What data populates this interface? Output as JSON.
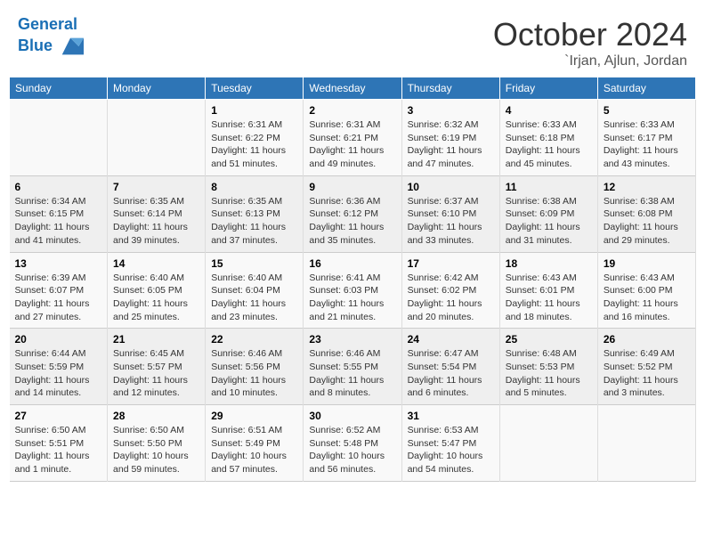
{
  "header": {
    "logo_line1": "General",
    "logo_line2": "Blue",
    "month": "October 2024",
    "location": "`Irjan, Ajlun, Jordan"
  },
  "weekdays": [
    "Sunday",
    "Monday",
    "Tuesday",
    "Wednesday",
    "Thursday",
    "Friday",
    "Saturday"
  ],
  "weeks": [
    [
      null,
      null,
      {
        "day": "1",
        "sunrise": "Sunrise: 6:31 AM",
        "sunset": "Sunset: 6:22 PM",
        "daylight": "Daylight: 11 hours and 51 minutes."
      },
      {
        "day": "2",
        "sunrise": "Sunrise: 6:31 AM",
        "sunset": "Sunset: 6:21 PM",
        "daylight": "Daylight: 11 hours and 49 minutes."
      },
      {
        "day": "3",
        "sunrise": "Sunrise: 6:32 AM",
        "sunset": "Sunset: 6:19 PM",
        "daylight": "Daylight: 11 hours and 47 minutes."
      },
      {
        "day": "4",
        "sunrise": "Sunrise: 6:33 AM",
        "sunset": "Sunset: 6:18 PM",
        "daylight": "Daylight: 11 hours and 45 minutes."
      },
      {
        "day": "5",
        "sunrise": "Sunrise: 6:33 AM",
        "sunset": "Sunset: 6:17 PM",
        "daylight": "Daylight: 11 hours and 43 minutes."
      }
    ],
    [
      {
        "day": "6",
        "sunrise": "Sunrise: 6:34 AM",
        "sunset": "Sunset: 6:15 PM",
        "daylight": "Daylight: 11 hours and 41 minutes."
      },
      {
        "day": "7",
        "sunrise": "Sunrise: 6:35 AM",
        "sunset": "Sunset: 6:14 PM",
        "daylight": "Daylight: 11 hours and 39 minutes."
      },
      {
        "day": "8",
        "sunrise": "Sunrise: 6:35 AM",
        "sunset": "Sunset: 6:13 PM",
        "daylight": "Daylight: 11 hours and 37 minutes."
      },
      {
        "day": "9",
        "sunrise": "Sunrise: 6:36 AM",
        "sunset": "Sunset: 6:12 PM",
        "daylight": "Daylight: 11 hours and 35 minutes."
      },
      {
        "day": "10",
        "sunrise": "Sunrise: 6:37 AM",
        "sunset": "Sunset: 6:10 PM",
        "daylight": "Daylight: 11 hours and 33 minutes."
      },
      {
        "day": "11",
        "sunrise": "Sunrise: 6:38 AM",
        "sunset": "Sunset: 6:09 PM",
        "daylight": "Daylight: 11 hours and 31 minutes."
      },
      {
        "day": "12",
        "sunrise": "Sunrise: 6:38 AM",
        "sunset": "Sunset: 6:08 PM",
        "daylight": "Daylight: 11 hours and 29 minutes."
      }
    ],
    [
      {
        "day": "13",
        "sunrise": "Sunrise: 6:39 AM",
        "sunset": "Sunset: 6:07 PM",
        "daylight": "Daylight: 11 hours and 27 minutes."
      },
      {
        "day": "14",
        "sunrise": "Sunrise: 6:40 AM",
        "sunset": "Sunset: 6:05 PM",
        "daylight": "Daylight: 11 hours and 25 minutes."
      },
      {
        "day": "15",
        "sunrise": "Sunrise: 6:40 AM",
        "sunset": "Sunset: 6:04 PM",
        "daylight": "Daylight: 11 hours and 23 minutes."
      },
      {
        "day": "16",
        "sunrise": "Sunrise: 6:41 AM",
        "sunset": "Sunset: 6:03 PM",
        "daylight": "Daylight: 11 hours and 21 minutes."
      },
      {
        "day": "17",
        "sunrise": "Sunrise: 6:42 AM",
        "sunset": "Sunset: 6:02 PM",
        "daylight": "Daylight: 11 hours and 20 minutes."
      },
      {
        "day": "18",
        "sunrise": "Sunrise: 6:43 AM",
        "sunset": "Sunset: 6:01 PM",
        "daylight": "Daylight: 11 hours and 18 minutes."
      },
      {
        "day": "19",
        "sunrise": "Sunrise: 6:43 AM",
        "sunset": "Sunset: 6:00 PM",
        "daylight": "Daylight: 11 hours and 16 minutes."
      }
    ],
    [
      {
        "day": "20",
        "sunrise": "Sunrise: 6:44 AM",
        "sunset": "Sunset: 5:59 PM",
        "daylight": "Daylight: 11 hours and 14 minutes."
      },
      {
        "day": "21",
        "sunrise": "Sunrise: 6:45 AM",
        "sunset": "Sunset: 5:57 PM",
        "daylight": "Daylight: 11 hours and 12 minutes."
      },
      {
        "day": "22",
        "sunrise": "Sunrise: 6:46 AM",
        "sunset": "Sunset: 5:56 PM",
        "daylight": "Daylight: 11 hours and 10 minutes."
      },
      {
        "day": "23",
        "sunrise": "Sunrise: 6:46 AM",
        "sunset": "Sunset: 5:55 PM",
        "daylight": "Daylight: 11 hours and 8 minutes."
      },
      {
        "day": "24",
        "sunrise": "Sunrise: 6:47 AM",
        "sunset": "Sunset: 5:54 PM",
        "daylight": "Daylight: 11 hours and 6 minutes."
      },
      {
        "day": "25",
        "sunrise": "Sunrise: 6:48 AM",
        "sunset": "Sunset: 5:53 PM",
        "daylight": "Daylight: 11 hours and 5 minutes."
      },
      {
        "day": "26",
        "sunrise": "Sunrise: 6:49 AM",
        "sunset": "Sunset: 5:52 PM",
        "daylight": "Daylight: 11 hours and 3 minutes."
      }
    ],
    [
      {
        "day": "27",
        "sunrise": "Sunrise: 6:50 AM",
        "sunset": "Sunset: 5:51 PM",
        "daylight": "Daylight: 11 hours and 1 minute."
      },
      {
        "day": "28",
        "sunrise": "Sunrise: 6:50 AM",
        "sunset": "Sunset: 5:50 PM",
        "daylight": "Daylight: 10 hours and 59 minutes."
      },
      {
        "day": "29",
        "sunrise": "Sunrise: 6:51 AM",
        "sunset": "Sunset: 5:49 PM",
        "daylight": "Daylight: 10 hours and 57 minutes."
      },
      {
        "day": "30",
        "sunrise": "Sunrise: 6:52 AM",
        "sunset": "Sunset: 5:48 PM",
        "daylight": "Daylight: 10 hours and 56 minutes."
      },
      {
        "day": "31",
        "sunrise": "Sunrise: 6:53 AM",
        "sunset": "Sunset: 5:47 PM",
        "daylight": "Daylight: 10 hours and 54 minutes."
      },
      null,
      null
    ]
  ]
}
